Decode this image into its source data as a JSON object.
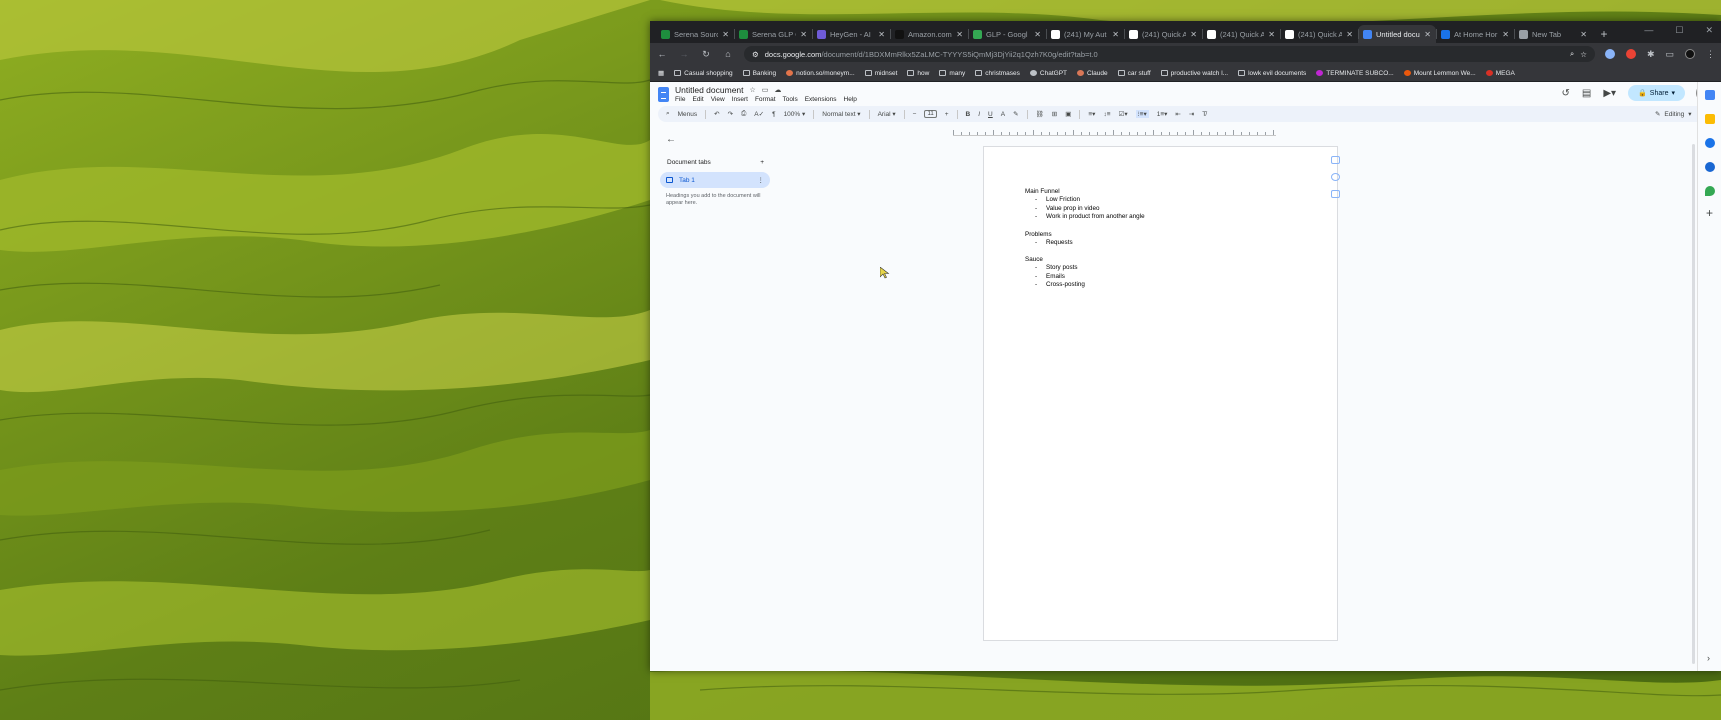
{
  "browser": {
    "tabs": [
      {
        "title": "Serena Sourc",
        "color": "#1e8e3e"
      },
      {
        "title": "Serena GLP C",
        "color": "#1e8e3e"
      },
      {
        "title": "HeyGen - AI",
        "color": "#6f5bd8"
      },
      {
        "title": "Amazon.com",
        "color": "#111111"
      },
      {
        "title": "GLP - Googl",
        "color": "#34a853"
      },
      {
        "title": "(241) My Aut",
        "color": "#ffffff"
      },
      {
        "title": "(241) Quick A",
        "color": "#ffffff"
      },
      {
        "title": "(241) Quick A",
        "color": "#ffffff"
      },
      {
        "title": "(241) Quick A",
        "color": "#ffffff"
      },
      {
        "title": "Untitled docu",
        "color": "#4285f4",
        "active": true
      },
      {
        "title": "At Home Hor",
        "color": "#1a73e8"
      },
      {
        "title": "New Tab",
        "color": "#9aa0a6"
      }
    ],
    "url_host": "docs.google.com",
    "url_rest": "/document/d/1BDXMmRlkx5ZaLMC-TYYYS5iQmMj3DjYii2q1Qzh7K0g/edit?tab=t.0",
    "bookmarks": [
      {
        "label": "Casual shopping",
        "icon": "page-icon"
      },
      {
        "label": "Banking",
        "icon": "folder-icon"
      },
      {
        "label": "notion.so/moneym...",
        "icon": "site-icon",
        "color": "#e3744a"
      },
      {
        "label": "midnset",
        "icon": "folder-icon"
      },
      {
        "label": "how",
        "icon": "folder-icon"
      },
      {
        "label": "many",
        "icon": "folder-icon"
      },
      {
        "label": "christmases",
        "icon": "folder-icon"
      },
      {
        "label": "ChatGPT",
        "icon": "site-icon",
        "color": "#bdc1c6"
      },
      {
        "label": "Claude",
        "icon": "site-icon",
        "color": "#d97757"
      },
      {
        "label": "car stuff",
        "icon": "folder-icon"
      },
      {
        "label": "productive watch l...",
        "icon": "folder-icon"
      },
      {
        "label": "lowk evil documents",
        "icon": "folder-icon"
      },
      {
        "label": "TERMINATE SUBCO...",
        "icon": "site-icon",
        "color": "#c026d3"
      },
      {
        "label": "Mount Lemmon We...",
        "icon": "site-icon",
        "color": "#ea580c"
      },
      {
        "label": "MEGA",
        "icon": "site-icon",
        "color": "#d93025"
      }
    ]
  },
  "docs": {
    "title": "Untitled document",
    "menus": [
      "File",
      "Edit",
      "View",
      "Insert",
      "Format",
      "Tools",
      "Extensions",
      "Help"
    ],
    "share_label": "Share",
    "toolbar": {
      "search": "Menus",
      "zoom": "100%",
      "style": "Normal text",
      "font": "Arial",
      "font_size": "11",
      "mode": "Editing"
    },
    "outline": {
      "label": "Document tabs",
      "tab_name": "Tab 1",
      "hint": "Headings you add to the document will appear here."
    },
    "content": [
      {
        "heading": "Main Funnel",
        "items": [
          "Low Friction",
          "Value prop in video",
          "Work in product from another angle"
        ]
      },
      {
        "heading": "Problems",
        "items": [
          "Requests"
        ]
      },
      {
        "heading": "Sauce",
        "items": [
          "Story posts",
          "Emails",
          "Cross-posting"
        ]
      }
    ]
  }
}
